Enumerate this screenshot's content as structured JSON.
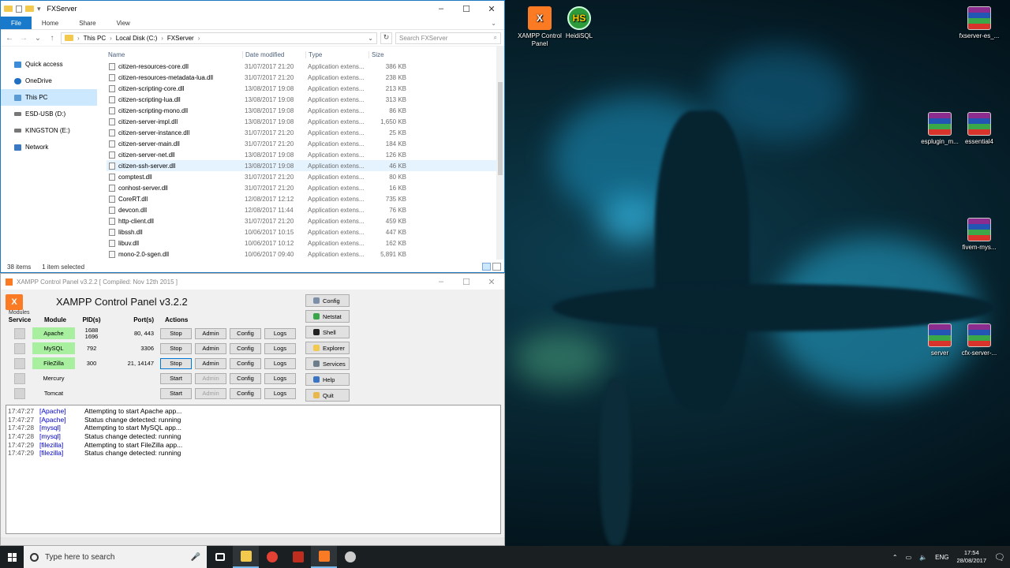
{
  "explorer": {
    "title": "FXServer",
    "ribbon_tabs": [
      "File",
      "Home",
      "Share",
      "View"
    ],
    "breadcrumb": [
      "This PC",
      "Local Disk (C:)",
      "FXServer"
    ],
    "search_placeholder": "Search FXServer",
    "nav_items": [
      {
        "label": "Quick access",
        "color": "#3c8cd8"
      },
      {
        "label": "OneDrive",
        "color": "#1f6fc2"
      },
      {
        "label": "This PC",
        "color": "#5a9bd4"
      },
      {
        "label": "ESD-USB (D:)",
        "color": "#777777"
      },
      {
        "label": "KINGSTON (E:)",
        "color": "#777777"
      },
      {
        "label": "Network",
        "color": "#3b78c4"
      }
    ],
    "columns": {
      "name": "Name",
      "date": "Date modified",
      "type": "Type",
      "size": "Size"
    },
    "files": [
      {
        "name": "citizen-resources-core.dll",
        "date": "31/07/2017 21:20",
        "type": "Application extens...",
        "size": "386 KB"
      },
      {
        "name": "citizen-resources-metadata-lua.dll",
        "date": "31/07/2017 21:20",
        "type": "Application extens...",
        "size": "238 KB"
      },
      {
        "name": "citizen-scripting-core.dll",
        "date": "13/08/2017 19:08",
        "type": "Application extens...",
        "size": "213 KB"
      },
      {
        "name": "citizen-scripting-lua.dll",
        "date": "13/08/2017 19:08",
        "type": "Application extens...",
        "size": "313 KB"
      },
      {
        "name": "citizen-scripting-mono.dll",
        "date": "13/08/2017 19:08",
        "type": "Application extens...",
        "size": "86 KB"
      },
      {
        "name": "citizen-server-impl.dll",
        "date": "13/08/2017 19:08",
        "type": "Application extens...",
        "size": "1,650 KB"
      },
      {
        "name": "citizen-server-instance.dll",
        "date": "31/07/2017 21:20",
        "type": "Application extens...",
        "size": "25 KB"
      },
      {
        "name": "citizen-server-main.dll",
        "date": "31/07/2017 21:20",
        "type": "Application extens...",
        "size": "184 KB"
      },
      {
        "name": "citizen-server-net.dll",
        "date": "13/08/2017 19:08",
        "type": "Application extens...",
        "size": "126 KB"
      },
      {
        "name": "citizen-ssh-server.dll",
        "date": "13/08/2017 19:08",
        "type": "Application extens...",
        "size": "46 KB"
      },
      {
        "name": "comptest.dll",
        "date": "31/07/2017 21:20",
        "type": "Application extens...",
        "size": "80 KB"
      },
      {
        "name": "conhost-server.dll",
        "date": "31/07/2017 21:20",
        "type": "Application extens...",
        "size": "16 KB"
      },
      {
        "name": "CoreRT.dll",
        "date": "12/08/2017 12:12",
        "type": "Application extens...",
        "size": "735 KB"
      },
      {
        "name": "devcon.dll",
        "date": "12/08/2017 11:44",
        "type": "Application extens...",
        "size": "76 KB"
      },
      {
        "name": "http-client.dll",
        "date": "31/07/2017 21:20",
        "type": "Application extens...",
        "size": "459 KB"
      },
      {
        "name": "libssh.dll",
        "date": "10/06/2017 10:15",
        "type": "Application extens...",
        "size": "447 KB"
      },
      {
        "name": "libuv.dll",
        "date": "10/06/2017 10:12",
        "type": "Application extens...",
        "size": "162 KB"
      },
      {
        "name": "mono-2.0-sgen.dll",
        "date": "10/06/2017 09:40",
        "type": "Application extens...",
        "size": "5,891 KB"
      }
    ],
    "status_items": "38 items",
    "status_selected": "1 item selected"
  },
  "xampp": {
    "title": "XAMPP Control Panel v3.2.2   [ Compiled: Nov 12th 2015 ]",
    "heading": "XAMPP Control Panel v3.2.2",
    "logo_text": "X",
    "modules_label": "Modules",
    "headers": {
      "service": "Service",
      "module": "Module",
      "pid": "PID(s)",
      "port": "Port(s)",
      "actions": "Actions"
    },
    "modules": [
      {
        "name": "Apache",
        "running": true,
        "pid1": "1688",
        "pid2": "1696",
        "ports": "80, 443",
        "action": "Stop",
        "admin_enabled": true
      },
      {
        "name": "MySQL",
        "running": true,
        "pid1": "792",
        "pid2": "",
        "ports": "3306",
        "action": "Stop",
        "admin_enabled": true
      },
      {
        "name": "FileZilla",
        "running": true,
        "pid1": "300",
        "pid2": "",
        "ports": "21, 14147",
        "action": "Stop",
        "admin_enabled": true
      },
      {
        "name": "Mercury",
        "running": false,
        "pid1": "",
        "pid2": "",
        "ports": "",
        "action": "Start",
        "admin_enabled": false
      },
      {
        "name": "Tomcat",
        "running": false,
        "pid1": "",
        "pid2": "",
        "ports": "",
        "action": "Start",
        "admin_enabled": false
      }
    ],
    "buttons": {
      "admin": "Admin",
      "config": "Config",
      "logs": "Logs"
    },
    "side_buttons": [
      {
        "label": "Config",
        "icon": "wrench-icon",
        "color": "#7b8fa8"
      },
      {
        "label": "Netstat",
        "icon": "globe-icon",
        "color": "#3aa64a"
      },
      {
        "label": "Shell",
        "icon": "terminal-icon",
        "color": "#222222"
      },
      {
        "label": "Explorer",
        "icon": "folder-icon",
        "color": "#f2c94c"
      },
      {
        "label": "Services",
        "icon": "services-icon",
        "color": "#6d7d8c"
      },
      {
        "label": "Help",
        "icon": "help-icon",
        "color": "#3a74c4"
      },
      {
        "label": "Quit",
        "icon": "quit-icon",
        "color": "#e8b84a"
      }
    ],
    "log": [
      {
        "time": "17:47:27",
        "module": "[Apache]",
        "msg": "Attempting to start Apache app..."
      },
      {
        "time": "17:47:27",
        "module": "[Apache]",
        "msg": "Status change detected: running"
      },
      {
        "time": "17:47:28",
        "module": "[mysql]",
        "msg": "Attempting to start MySQL app..."
      },
      {
        "time": "17:47:28",
        "module": "[mysql]",
        "msg": "Status change detected: running"
      },
      {
        "time": "17:47:29",
        "module": "[filezilla]",
        "msg": "Attempting to start FileZilla app..."
      },
      {
        "time": "17:47:29",
        "module": "[filezilla]",
        "msg": "Status change detected: running"
      }
    ]
  },
  "desktop_icons": [
    {
      "label": "XAMPP Control Panel",
      "glyph": "X",
      "kind": "xampp"
    },
    {
      "label": "HeidiSQL",
      "glyph": "HS",
      "kind": "heidi"
    },
    {
      "label": "fxserver-es_...",
      "glyph": "",
      "kind": "rar"
    },
    {
      "label": "esplugin_m...",
      "glyph": "",
      "kind": "rar"
    },
    {
      "label": "essential4",
      "glyph": "",
      "kind": "rar"
    },
    {
      "label": "fivem-mys...",
      "glyph": "",
      "kind": "rar"
    },
    {
      "label": "server",
      "glyph": "",
      "kind": "rar"
    },
    {
      "label": "cfx-server-...",
      "glyph": "",
      "kind": "rar"
    }
  ],
  "taskbar": {
    "search_placeholder": "Type here to search",
    "pinned": [
      {
        "name": "task-view-icon",
        "color": "#ffffff"
      },
      {
        "name": "file-explorer-icon",
        "color": "#f2c94c"
      },
      {
        "name": "chrome-icon",
        "color": "#e34133"
      },
      {
        "name": "filezilla-icon",
        "color": "#bf2d1f"
      },
      {
        "name": "xampp-icon",
        "color": "#fb7a24"
      },
      {
        "name": "steam-icon",
        "color": "#cccccc"
      }
    ],
    "lang": "ENG",
    "time": "17:54",
    "date": "28/08/2017"
  }
}
